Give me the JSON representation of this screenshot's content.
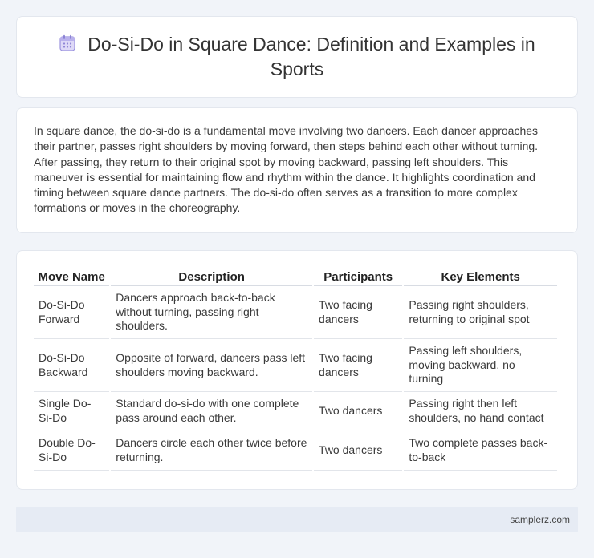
{
  "header": {
    "title": "Do-Si-Do in Square Dance: Definition and Examples in Sports",
    "icon": "calendar-icon"
  },
  "intro": {
    "text": "In square dance, the do-si-do is a fundamental move involving two dancers. Each dancer approaches their partner, passes right shoulders by moving forward, then steps behind each other without turning. After passing, they return to their original spot by moving backward, passing left shoulders. This maneuver is essential for maintaining flow and rhythm within the dance. It highlights coordination and timing between square dance partners. The do-si-do often serves as a transition to more complex formations or moves in the choreography."
  },
  "table": {
    "headers": [
      "Move Name",
      "Description",
      "Participants",
      "Key Elements"
    ],
    "rows": [
      [
        "Do-Si-Do Forward",
        "Dancers approach back-to-back without turning, passing right shoulders.",
        "Two facing dancers",
        "Passing right shoulders, returning to original spot"
      ],
      [
        "Do-Si-Do Backward",
        "Opposite of forward, dancers pass left shoulders moving backward.",
        "Two facing dancers",
        "Passing left shoulders, moving backward, no turning"
      ],
      [
        "Single Do-Si-Do",
        "Standard do-si-do with one complete pass around each other.",
        "Two dancers",
        "Passing right then left shoulders, no hand contact"
      ],
      [
        "Double Do-Si-Do",
        "Dancers circle each other twice before returning.",
        "Two dancers",
        "Two complete passes back-to-back"
      ]
    ]
  },
  "footer": {
    "site": "samplerz.com"
  },
  "colors": {
    "background": "#f1f4f9",
    "card": "#ffffff",
    "footer": "#e6ebf4",
    "icon": "#8f86d6"
  }
}
